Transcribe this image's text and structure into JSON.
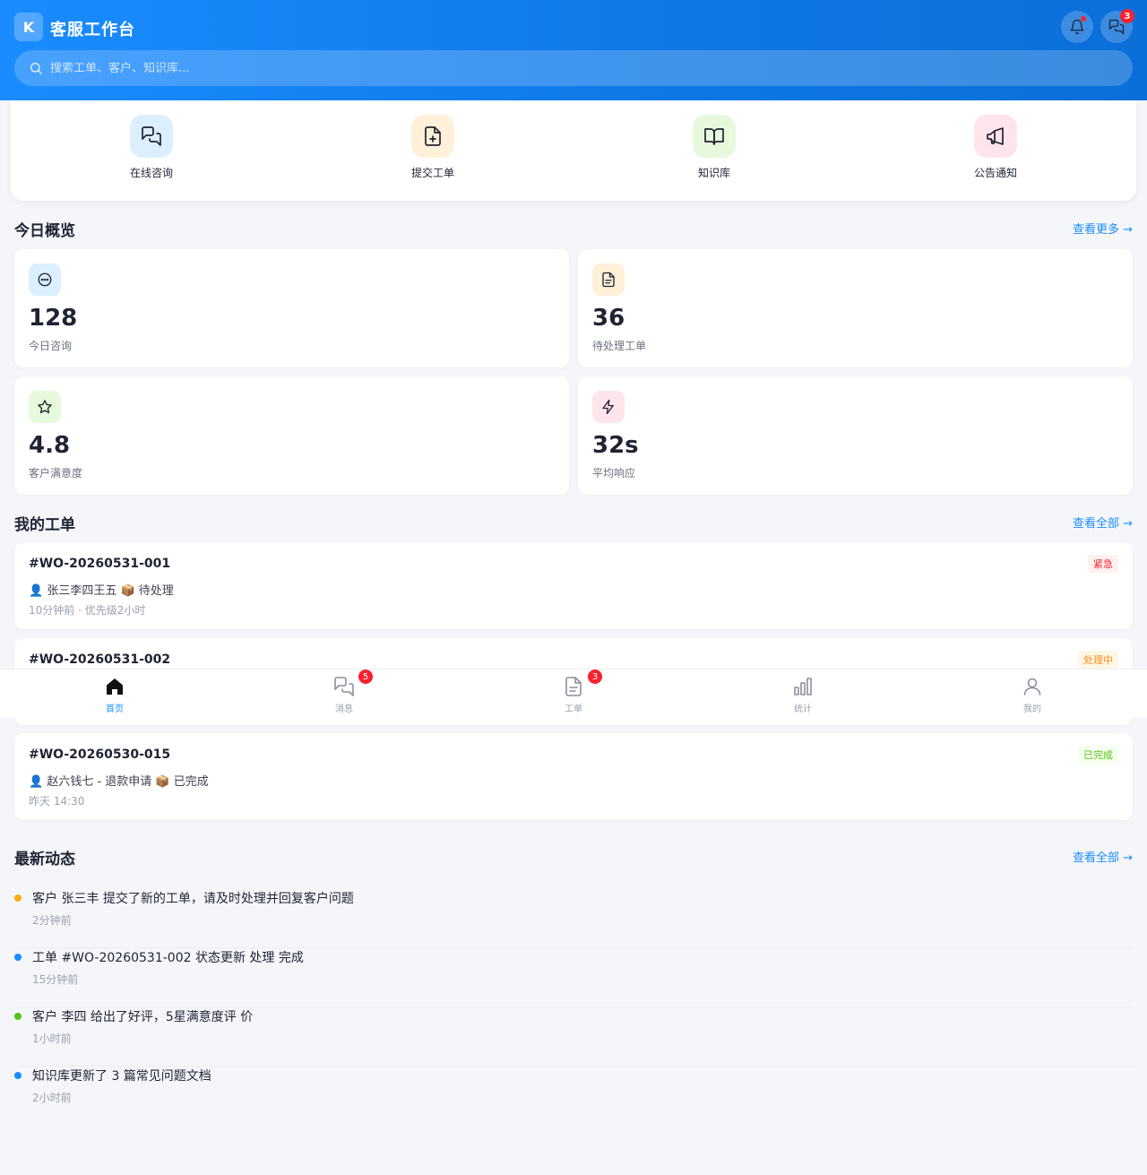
{
  "header": {
    "logo_letter": "K",
    "title": "客服工作台",
    "notification_icon": "bell-icon",
    "messages_icon": "chat-icon",
    "messages_badge": "3",
    "search_placeholder": "搜索工单、客户、知识库..."
  },
  "quick_actions": [
    {
      "label": "在线咨询",
      "icon": "chat-bubbles-icon",
      "bg": "#dbefff"
    },
    {
      "label": "提交工单",
      "icon": "file-plus-icon",
      "bg": "#fff0d9"
    },
    {
      "label": "知识库",
      "icon": "book-open-icon",
      "bg": "#e6f9dc"
    },
    {
      "label": "公告通知",
      "icon": "megaphone-icon",
      "bg": "#ffe4ec"
    }
  ],
  "stats_section": {
    "title": "今日概览",
    "more": "查看更多 →"
  },
  "stats": [
    {
      "value": "128",
      "label": "今日咨询",
      "icon": "message-circle-icon",
      "bg": "#dbefff"
    },
    {
      "value": "36",
      "label": "待处理工单",
      "icon": "file-text-icon",
      "bg": "#fff0d9"
    },
    {
      "value": "4.8",
      "label": "客户满意度",
      "icon": "star-icon",
      "bg": "#e6f9dc"
    },
    {
      "value": "32s",
      "label": "平均响应",
      "icon": "lightning-icon",
      "bg": "#ffe4ec"
    }
  ],
  "tickets_section": {
    "title": "我的工单",
    "more": "查看全部 →"
  },
  "tickets": [
    {
      "id": "#WO-20260531-001",
      "desc": "👤 张三李四王五   📦 待处理",
      "meta": "10分钟前 · 优先级2小时",
      "tag": "紧急",
      "tag_color": "#f5222d",
      "tag_bg": "#fff1f0"
    },
    {
      "id": "#WO-20260531-002",
      "desc": "",
      "meta": "",
      "tag": "处理中",
      "tag_color": "#fa8c16",
      "tag_bg": "#fff7e6"
    },
    {
      "id": "#WO-20260530-015",
      "desc": "👤 赵六钱七 - 退款申请   📦 已完成",
      "meta": "昨天 14:30",
      "tag": "已完成",
      "tag_color": "#52c41a",
      "tag_bg": "#f6ffed"
    }
  ],
  "activity_section": {
    "title": "最新动态",
    "more": "查看全部 →"
  },
  "activity": [
    {
      "text": "客户 张三丰 提交了新的工单，请及时处理并回复客户问题",
      "time": "2分钟前",
      "dot": "#faad14"
    },
    {
      "text": "工单 #WO-20260531-002 状态更新 处理 完成",
      "time": "15分钟前",
      "dot": "#1a8cff"
    },
    {
      "text": "客户 李四 给出了好评，5星满意度评 价",
      "time": "1小时前",
      "dot": "#52c41a"
    },
    {
      "text": "知识库更新了 3 篇常见问题文档",
      "time": "2小时前",
      "dot": "#1a8cff"
    }
  ],
  "bottom_nav": [
    {
      "label": "首页",
      "icon": "home-icon",
      "badge": ""
    },
    {
      "label": "消息",
      "icon": "chat-icon",
      "badge": "5"
    },
    {
      "label": "工单",
      "icon": "file-icon",
      "badge": "3"
    },
    {
      "label": "统计",
      "icon": "bar-chart-icon",
      "badge": ""
    },
    {
      "label": "我的",
      "icon": "user-icon",
      "badge": ""
    }
  ],
  "colors": {
    "primary": "#1a8cff",
    "danger": "#f5222d",
    "warning": "#faad14",
    "success": "#52c41a"
  }
}
